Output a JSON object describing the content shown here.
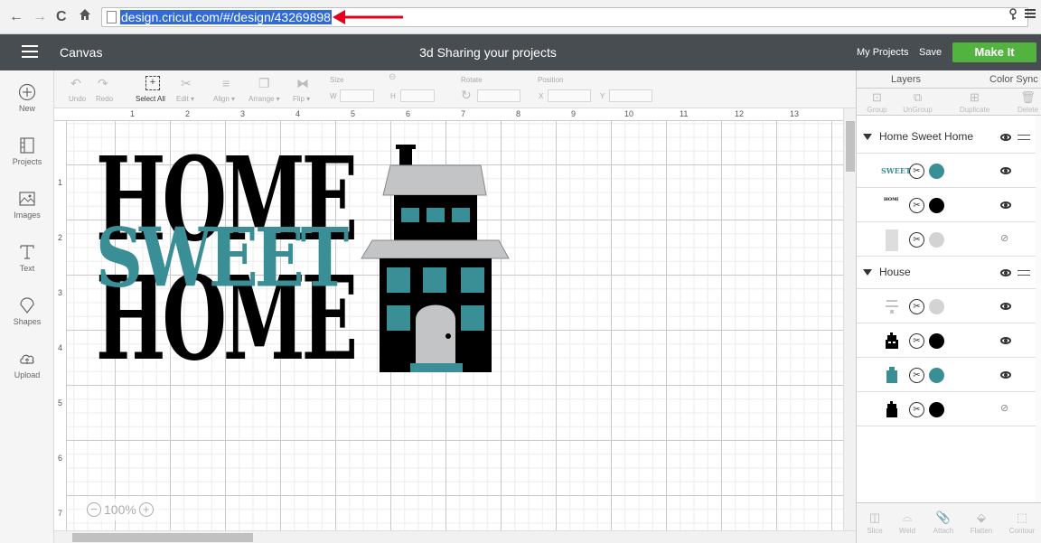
{
  "browser": {
    "back": "←",
    "forward": "→",
    "reload": "C",
    "home": "🏠",
    "url": "design.cricut.com/#/design/43269898"
  },
  "header": {
    "canvas_label": "Canvas",
    "project_title": "3d Sharing your projects",
    "my_projects": "My Projects",
    "save": "Save",
    "make_it": "Make It"
  },
  "left_bar": {
    "items": [
      {
        "label": "New",
        "icon": "plus-circle-icon"
      },
      {
        "label": "Projects",
        "icon": "projects-icon"
      },
      {
        "label": "Images",
        "icon": "images-icon"
      },
      {
        "label": "Text",
        "icon": "text-icon"
      },
      {
        "label": "Shapes",
        "icon": "shapes-icon"
      },
      {
        "label": "Upload",
        "icon": "upload-icon"
      }
    ]
  },
  "edit_bar": {
    "undo": "Undo",
    "redo": "Redo",
    "select_all": "Select All",
    "edit": "Edit ▾",
    "align": "Align ▾",
    "arrange": "Arrange ▾",
    "flip": "Flip ▾",
    "size": "Size",
    "w": "W",
    "h": "H",
    "rotate": "Rotate",
    "position": "Position",
    "x": "X",
    "y": "Y"
  },
  "ruler": {
    "h": [
      "1",
      "2",
      "3",
      "4",
      "5",
      "6",
      "7",
      "8",
      "9",
      "10",
      "11",
      "12",
      "13"
    ],
    "v": [
      "1",
      "2",
      "3",
      "4",
      "5",
      "6",
      "7"
    ]
  },
  "artwork": {
    "home_top": "HOME",
    "sweet": "SWEET",
    "home_bottom": "HOME",
    "colors": {
      "black": "#000000",
      "teal": "#3a8e96",
      "gray": "#c3c4c6"
    }
  },
  "zoom": {
    "value": "100%",
    "minus": "−",
    "plus": "+"
  },
  "panel": {
    "tab_layers": "Layers",
    "tab_color_sync": "Color Sync",
    "tools": [
      "Group",
      "UnGroup",
      "Duplicate",
      "Delete"
    ],
    "groups": [
      {
        "name": "Home Sweet Home"
      },
      {
        "name": "House"
      }
    ],
    "layers_group1": [
      {
        "thumb": "SWEET",
        "color": "#3a8e96",
        "visible": true
      },
      {
        "thumb": "HOME",
        "color": "#000000",
        "visible": true
      },
      {
        "thumb": "",
        "color": "#cccccc",
        "visible": false
      }
    ],
    "layers_group2": [
      {
        "color": "#cccccc",
        "visible": true
      },
      {
        "color": "#000000",
        "visible": true
      },
      {
        "color": "#3a8e96",
        "visible": true
      },
      {
        "color": "#000000",
        "visible": false
      }
    ],
    "bottom_tools": [
      "Slice",
      "Weld",
      "Attach",
      "Flatten",
      "Contour"
    ]
  }
}
